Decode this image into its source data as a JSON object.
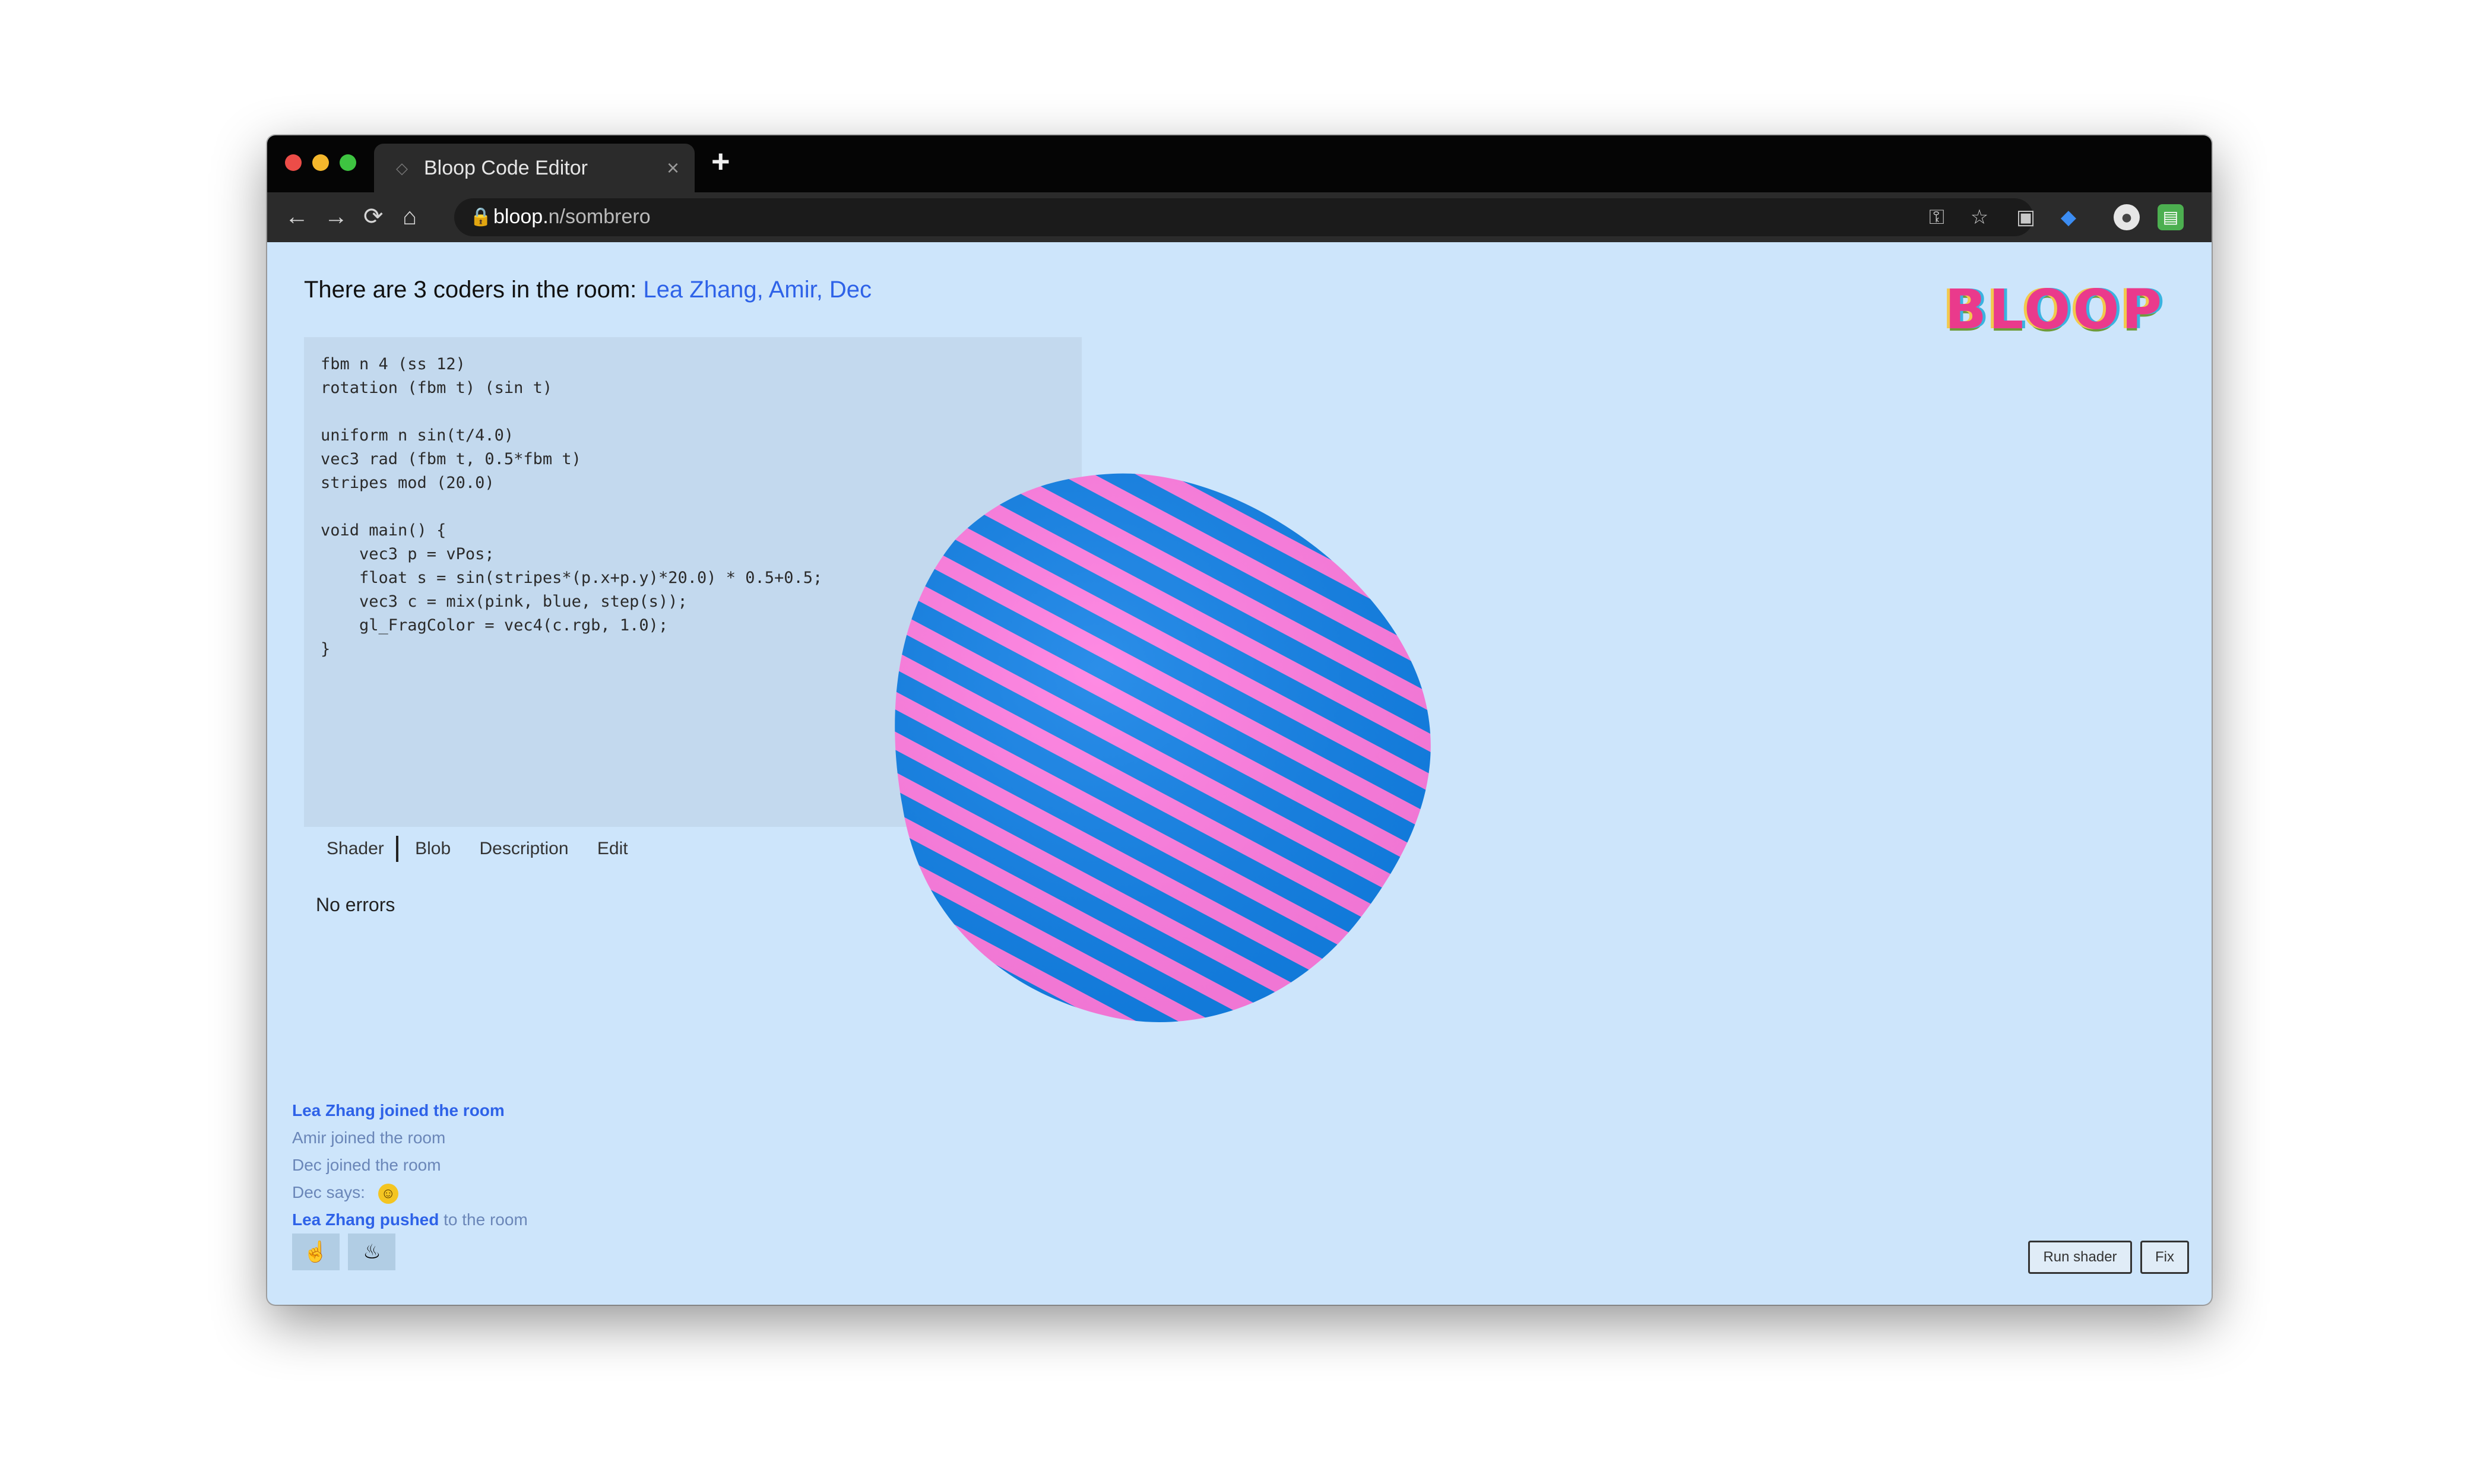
{
  "browser": {
    "tab_title": "Bloop Code Editor",
    "tab_close": "×",
    "new_tab": "+",
    "url_host": "bloop.",
    "url_path": "n/sombrero",
    "nav": {
      "back": "←",
      "forward": "→",
      "reload": "⟳",
      "home": "⌂"
    }
  },
  "page": {
    "presence_prefix": "There are 3 coders in the room:",
    "presence_names": "Lea Zhang, Amir, Dec",
    "logo": "BLOOP",
    "code": "fbm n 4 (ss 12)\nrotation (fbm t) (sin t)\n\nuniform n sin(t/4.0)\nvec3 rad (fbm t, 0.5*fbm t)\nstripes mod (20.0)\n\nvoid main() {\n    vec3 p = vPos;\n    float s = sin(stripes*(p.x+p.y)*20.0) * 0.5+0.5;\n    vec3 c = mix(pink, blue, step(s));\n    gl_FragColor = vec4(c.rgb, 1.0);\n}",
    "panel_tabs": [
      "Shader",
      "Blob",
      "Description",
      "Edit"
    ],
    "status": "No errors",
    "events": [
      {
        "name": "Lea Zhang",
        "action": "joined the room",
        "rest": ""
      },
      {
        "name": "",
        "action": "",
        "rest": "Amir joined the room"
      },
      {
        "name": "",
        "action": "",
        "rest": "Dec joined the room"
      },
      {
        "name": "",
        "action": "",
        "rest": "Dec says: ",
        "emoji": "☺"
      },
      {
        "name": "Lea Zhang",
        "action": "pushed",
        "rest": "to the room"
      }
    ],
    "reactions": [
      "☝",
      "♨"
    ],
    "controls": [
      "Run shader",
      "Fix"
    ]
  },
  "colors": {
    "background": "#cde5fb",
    "stripe_pink": "#ff7be0",
    "stripe_blue": "#0f7fe6",
    "link_blue": "#2e62e8"
  }
}
